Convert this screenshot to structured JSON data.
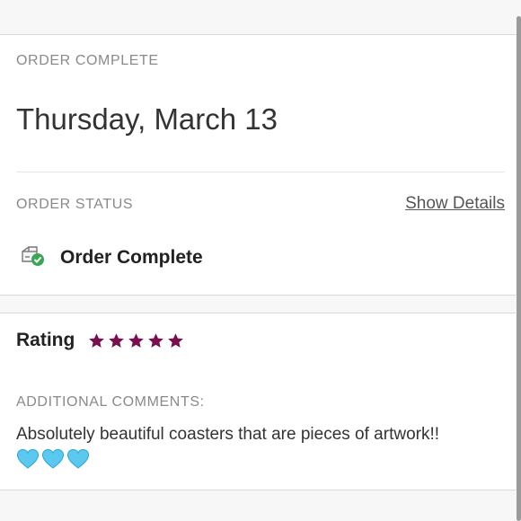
{
  "order": {
    "header_label": "ORDER COMPLETE",
    "date": "Thursday, March 13",
    "status_label": "ORDER STATUS",
    "show_details": "Show Details",
    "status_text": "Order Complete"
  },
  "review": {
    "rating_label": "Rating",
    "rating": 5,
    "rating_max": 5,
    "comments_label": "ADDITIONAL COMMENTS:",
    "comment_text": "Absolutely beautiful coasters that are pieces of artwork!!",
    "comment_emoji": [
      "light-blue-heart",
      "light-blue-heart",
      "light-blue-heart"
    ]
  },
  "colors": {
    "star": "#7a0f4f",
    "heart": "#5ac8ef",
    "check": "#3aa757"
  }
}
